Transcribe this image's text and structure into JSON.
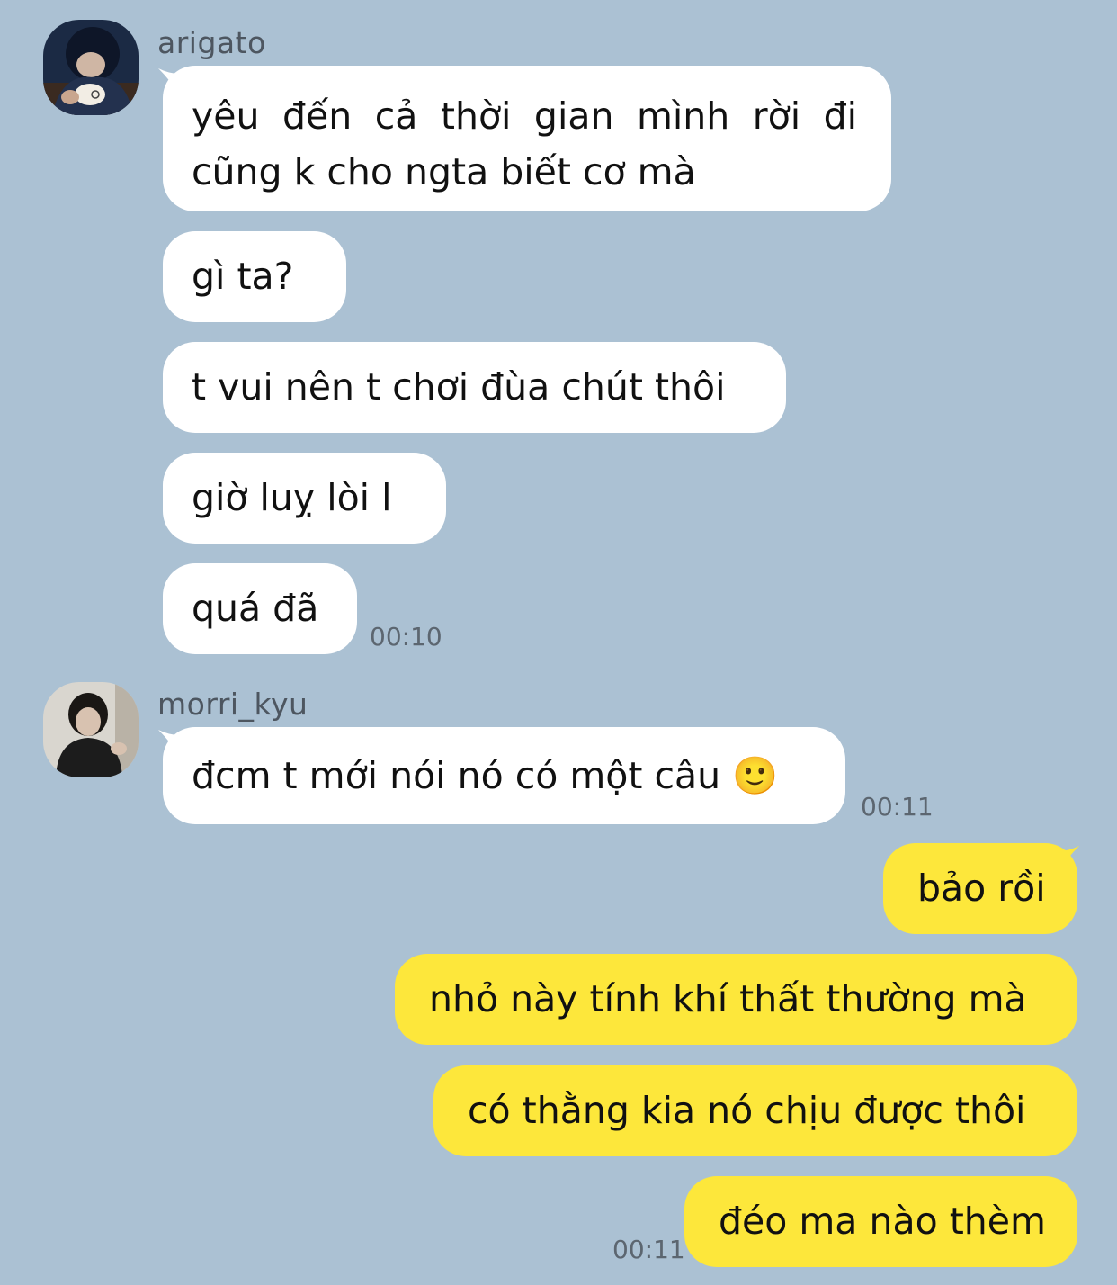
{
  "messages": {
    "group1": {
      "sender": "arigato",
      "avatar_icon": "profile-photo-person-drinking-from-cup",
      "bubbles": [
        "yêu đến cả thời gian mình rời đi cũng k cho ngta biết cơ mà",
        "gì ta?",
        "t vui nên t chơi đùa chút thôi",
        "giờ luỵ lòi l",
        "quá đã"
      ],
      "time": "00:10"
    },
    "group2": {
      "sender": "morri_kyu",
      "avatar_icon": "profile-photo-person-dark-hair",
      "bubbles": [
        "đcm t mới nói nó có một câu 🙂"
      ],
      "time": "00:11"
    },
    "group3": {
      "bubbles": [
        "bảo rồi",
        "nhỏ này tính khí thất thường mà",
        "có thằng kia nó chịu được thôi",
        "đéo ma nào thèm"
      ],
      "time": "00:11"
    }
  },
  "colors": {
    "background": "#abc1d3",
    "incoming_bubble": "#ffffff",
    "outgoing_bubble": "#fde73b"
  }
}
